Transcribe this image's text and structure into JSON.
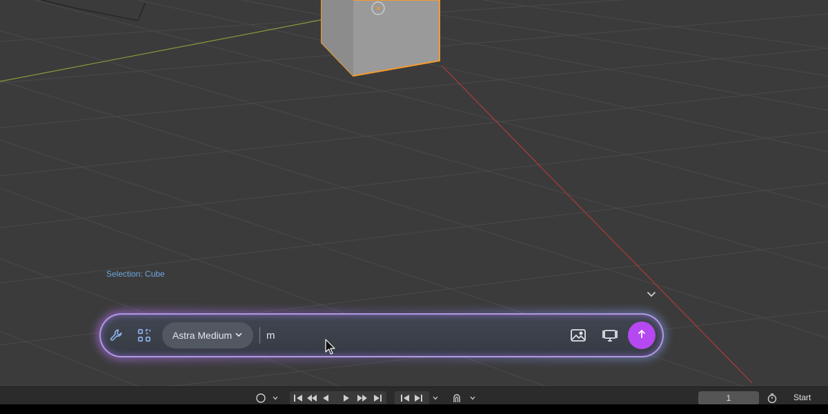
{
  "viewport": {
    "selection_label": "Selection: Cube"
  },
  "prompt_bar": {
    "model_label": "Astra Medium",
    "input_value": "m",
    "icons": {
      "tools": "wrench-icon",
      "apps": "grid-icon",
      "image": "image-icon",
      "screen": "monitor-icon",
      "send": "arrow-up-icon"
    },
    "colors": {
      "send_button": "#b548f0",
      "glow": "#be78ff"
    }
  },
  "timeline": {
    "current_frame": "1",
    "start_label": "Start"
  }
}
